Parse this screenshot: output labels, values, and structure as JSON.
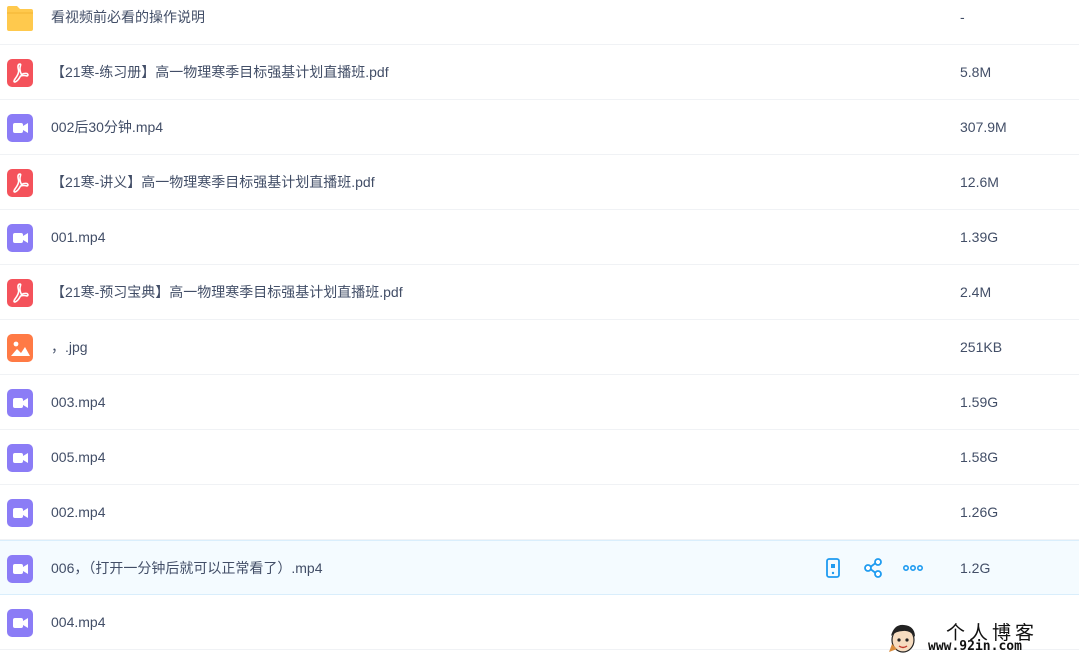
{
  "colors": {
    "folder": "#ffc94d",
    "pdf": "#f4525b",
    "video": "#8b7cf6",
    "image": "#ff7a45",
    "action": "#1e9bf0",
    "text": "#424e67",
    "hover_row": "#f4fbff"
  },
  "files": [
    {
      "name": "看视频前必看的操作说明",
      "size": "-",
      "type": "folder",
      "icon": "folder-icon"
    },
    {
      "name": "【21寒-练习册】高一物理寒季目标强基计划直播班.pdf",
      "size": "5.8M",
      "type": "pdf",
      "icon": "pdf-icon"
    },
    {
      "name": "002后30分钟.mp4",
      "size": "307.9M",
      "type": "video",
      "icon": "video-icon"
    },
    {
      "name": "【21寒-讲义】高一物理寒季目标强基计划直播班.pdf",
      "size": "12.6M",
      "type": "pdf",
      "icon": "pdf-icon"
    },
    {
      "name": "001.mp4",
      "size": "1.39G",
      "type": "video",
      "icon": "video-icon"
    },
    {
      "name": "【21寒-预习宝典】高一物理寒季目标强基计划直播班.pdf",
      "size": "2.4M",
      "type": "pdf",
      "icon": "pdf-icon"
    },
    {
      "name": "，.jpg",
      "size": "251KB",
      "type": "image",
      "icon": "image-icon"
    },
    {
      "name": "003.mp4",
      "size": "1.59G",
      "type": "video",
      "icon": "video-icon"
    },
    {
      "name": "005.mp4",
      "size": "1.58G",
      "type": "video",
      "icon": "video-icon"
    },
    {
      "name": "002.mp4",
      "size": "1.26G",
      "type": "video",
      "icon": "video-icon"
    },
    {
      "name": "006，（打开一分钟后就可以正常看了）.mp4",
      "size": "1.2G",
      "type": "video",
      "icon": "video-icon",
      "hover": true
    },
    {
      "name": "004.mp4",
      "size": "",
      "type": "video",
      "icon": "video-icon"
    }
  ],
  "row_actions": [
    {
      "icon": "phone-icon"
    },
    {
      "icon": "share-icon"
    },
    {
      "icon": "more-icon"
    }
  ],
  "watermark": {
    "title": "个人博客",
    "url": "www.92in.com"
  }
}
